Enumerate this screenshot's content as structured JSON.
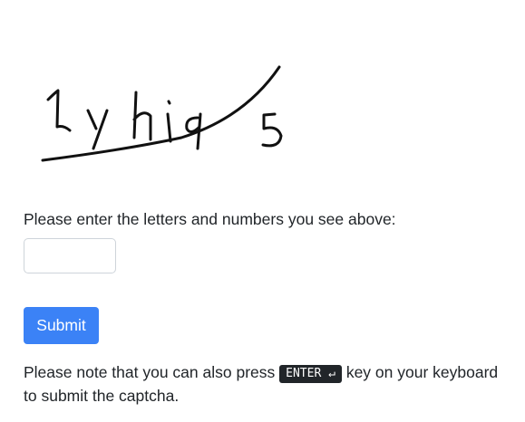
{
  "captcha": {
    "text": "1yhiq5",
    "icon": "captcha-image"
  },
  "form": {
    "prompt": "Please enter the letters and numbers you see above:",
    "input_value": "",
    "input_placeholder": "",
    "submit_label": "Submit"
  },
  "note": {
    "before": "Please note that you can also press",
    "key_label": "ENTER ↵",
    "after": "key on your keyboard to submit the captcha."
  },
  "colors": {
    "submit_bg": "#3b82f6",
    "key_bg": "#212529",
    "text": "#212529"
  }
}
